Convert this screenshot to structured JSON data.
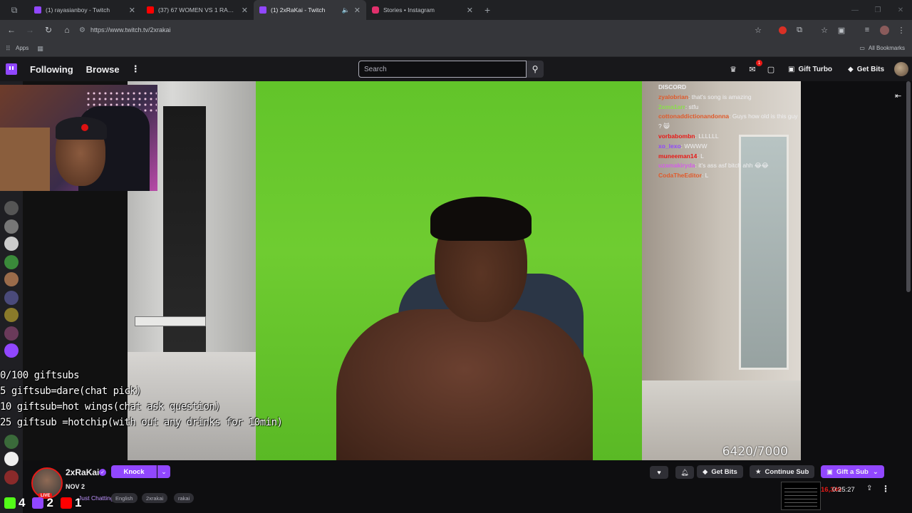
{
  "browser": {
    "tabs": [
      {
        "title": "(1) rayasianboy - Twitch",
        "color": "#9147ff",
        "active": false
      },
      {
        "title": "(37) 67 WOMEN VS 1 RAPPER :",
        "color": "#ff0000",
        "active": false
      },
      {
        "title": "(1) 2xRaKai - Twitch",
        "color": "#9147ff",
        "active": true
      },
      {
        "title": "Stories • Instagram",
        "color": "#e1306c",
        "active": false
      }
    ],
    "url": "https://www.twitch.tv/2xrakai",
    "bookmarks": {
      "apps": "Apps",
      "all": "All Bookmarks"
    }
  },
  "twitch_nav": {
    "following": "Following",
    "browse": "Browse",
    "search_placeholder": "Search",
    "notification_count": "1",
    "gift_turbo": "Gift Turbo",
    "get_bits": "Get Bits"
  },
  "stream": {
    "goal_text": "6420/7000",
    "overlay_lines": [
      "0/100 giftsubs",
      "5 giftsub=dare(chat pick)",
      "10 giftsub=hot wings(chat ask question)",
      "25 giftsub =hotchip(with out any drinks for 10min)"
    ]
  },
  "chat": {
    "header": "DISCORD",
    "messages": [
      {
        "user": "zyalobrian",
        "color": "#e05a2b",
        "text": ": that's song is amazing"
      },
      {
        "user": "2xma1arr",
        "color": "#8be04a",
        "text": ": stfu"
      },
      {
        "user": "cottonaddictionandonna",
        "color": "#e05a2b",
        "text": ": Guys how old is this guy ? 😸"
      },
      {
        "user": "vorbabombn",
        "color": "#e91916",
        "text": ": LLLLLL"
      },
      {
        "user": "xo_lexo",
        "color": "#9147ff",
        "text": ": WWWW"
      },
      {
        "user": "muneeman14",
        "color": "#e91916",
        "text": ": L"
      },
      {
        "user": "uzamakiryda",
        "color": "#d35ee8",
        "text": ": it's ass asf bitch ahh 😂😂"
      },
      {
        "user": "CodaTheEditor",
        "color": "#e05a2b",
        "text": ": L"
      }
    ]
  },
  "channel": {
    "name": "2xRaKai",
    "knock": "Knock",
    "date": "NOV 2",
    "category": "Just Chatting",
    "tags": [
      "English",
      "2xrakai",
      "rakai"
    ],
    "live_label": "LIVE",
    "get_bits": "Get Bits",
    "continue_sub": "Continue Sub",
    "gift_sub": "Gift a Sub",
    "viewers": "16,349",
    "uptime": "0:25:27"
  },
  "platform_counts": [
    {
      "label": "4",
      "color": "#53fc18"
    },
    {
      "label": "2",
      "color": "#9147ff"
    },
    {
      "label": "1",
      "color": "#ff0000"
    }
  ],
  "icons": [
    "back-icon",
    "forward-icon",
    "reload-icon",
    "home-icon",
    "site-info-icon",
    "star-icon",
    "extension-icon",
    "tab-search-icon",
    "menu-icon",
    "twitch-logo",
    "search-icon",
    "crown-icon",
    "inbox-icon",
    "whispers-icon",
    "bits-icon",
    "heart-icon",
    "bell-icon",
    "share-icon",
    "more-icon"
  ]
}
